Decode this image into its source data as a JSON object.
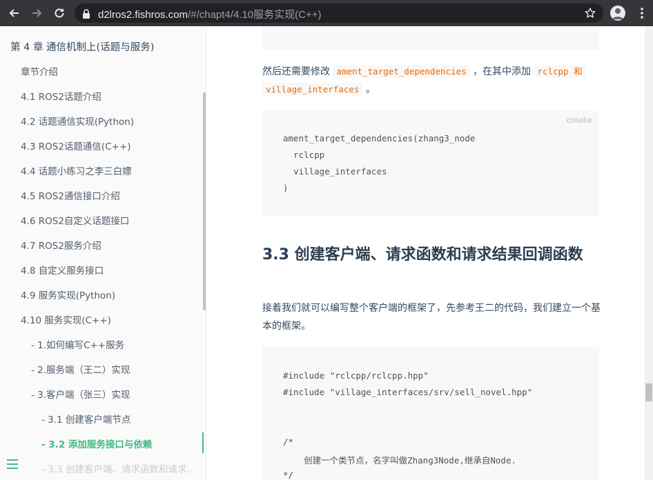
{
  "browser": {
    "url_host": "d2lros2.fishros.com",
    "url_path": "/#/chapt4/4.10服务实现(C++)"
  },
  "sidebar": {
    "chapter_title": "第 4 章 通信机制上(话题与服务)",
    "items": [
      {
        "label": "章节介绍"
      },
      {
        "label": "4.1 ROS2话题介绍"
      },
      {
        "label": "4.2 话题通信实现(Python)"
      },
      {
        "label": "4.3 ROS2话题通信(C++)"
      },
      {
        "label": "4.4 话题小练习之李三白嫖"
      },
      {
        "label": "4.5 ROS2通信接口介绍"
      },
      {
        "label": "4.6 ROS2自定义话题接口"
      },
      {
        "label": "4.7 ROS2服务介绍"
      },
      {
        "label": "4.8 自定义服务接口"
      },
      {
        "label": "4.9 服务实现(Python)"
      },
      {
        "label": "4.10 服务实现(C++)"
      },
      {
        "label": "- 1.如何编写C++服务"
      },
      {
        "label": "- 2.服务端（王二）实现"
      },
      {
        "label": "- 3.客户端（张三）实现"
      },
      {
        "label": "- 3.1 创建客户端节点"
      },
      {
        "label": "- 3.2 添加服务接口与依赖"
      },
      {
        "label": "- 3.3 创建客户端、请求函数和请求..."
      }
    ]
  },
  "content": {
    "para1_prefix": "然后还需要修改",
    "para1_code1": "ament_target_dependencies",
    "para1_mid": "，在其中添加",
    "para1_code2a": "rclcpp 和",
    "para1_code2b": "village_interfaces",
    "para1_suffix": "。",
    "code1_lang": "cmake",
    "code1_lines": [
      "ament_target_dependencies(zhang3_node",
      "  rclcpp",
      "  village_interfaces",
      ")"
    ],
    "heading": "3.3 创建客户端、请求函数和请求结果回调函数",
    "para2": "接着我们就可以编写整个客户端的框架了，先参考王二的代码，我们建立一个基本的框架。",
    "code2_lines": [
      "#include \"rclcpp/rclcpp.hpp\"",
      "#include \"village_interfaces/srv/sell_novel.hpp\"",
      "",
      "",
      "/*",
      "    创建一个类节点，名字叫做Zhang3Node,继承自Node.",
      "*/"
    ]
  }
}
